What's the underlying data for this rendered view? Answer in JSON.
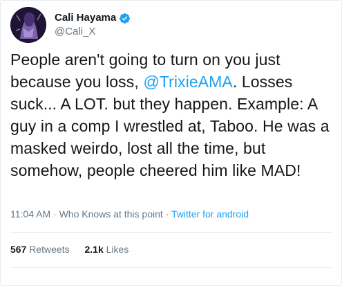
{
  "user": {
    "display_name": "Cali Hayama",
    "handle": "@Cali_X",
    "verified": true
  },
  "tweet": {
    "text_before_mention": "People aren't going to turn on you just because you loss, ",
    "mention": "@TrixieAMA",
    "text_after_mention": ". Losses suck... A LOT. but they happen. Example: A guy in a comp I wrestled at, Taboo. He was a masked weirdo, lost all the time, but somehow, people cheered him like MAD!"
  },
  "meta": {
    "time": "11:04 AM",
    "sep1": " · ",
    "location": "Who Knows at this point",
    "sep2": " · ",
    "source": "Twitter for android"
  },
  "stats": {
    "retweets_count": "567",
    "retweets_label": "Retweets",
    "likes_count": "2.1k",
    "likes_label": "Likes"
  },
  "colors": {
    "accent": "#1da1f2",
    "text": "#14171a",
    "muted": "#657786",
    "border": "#e6ecf0"
  }
}
